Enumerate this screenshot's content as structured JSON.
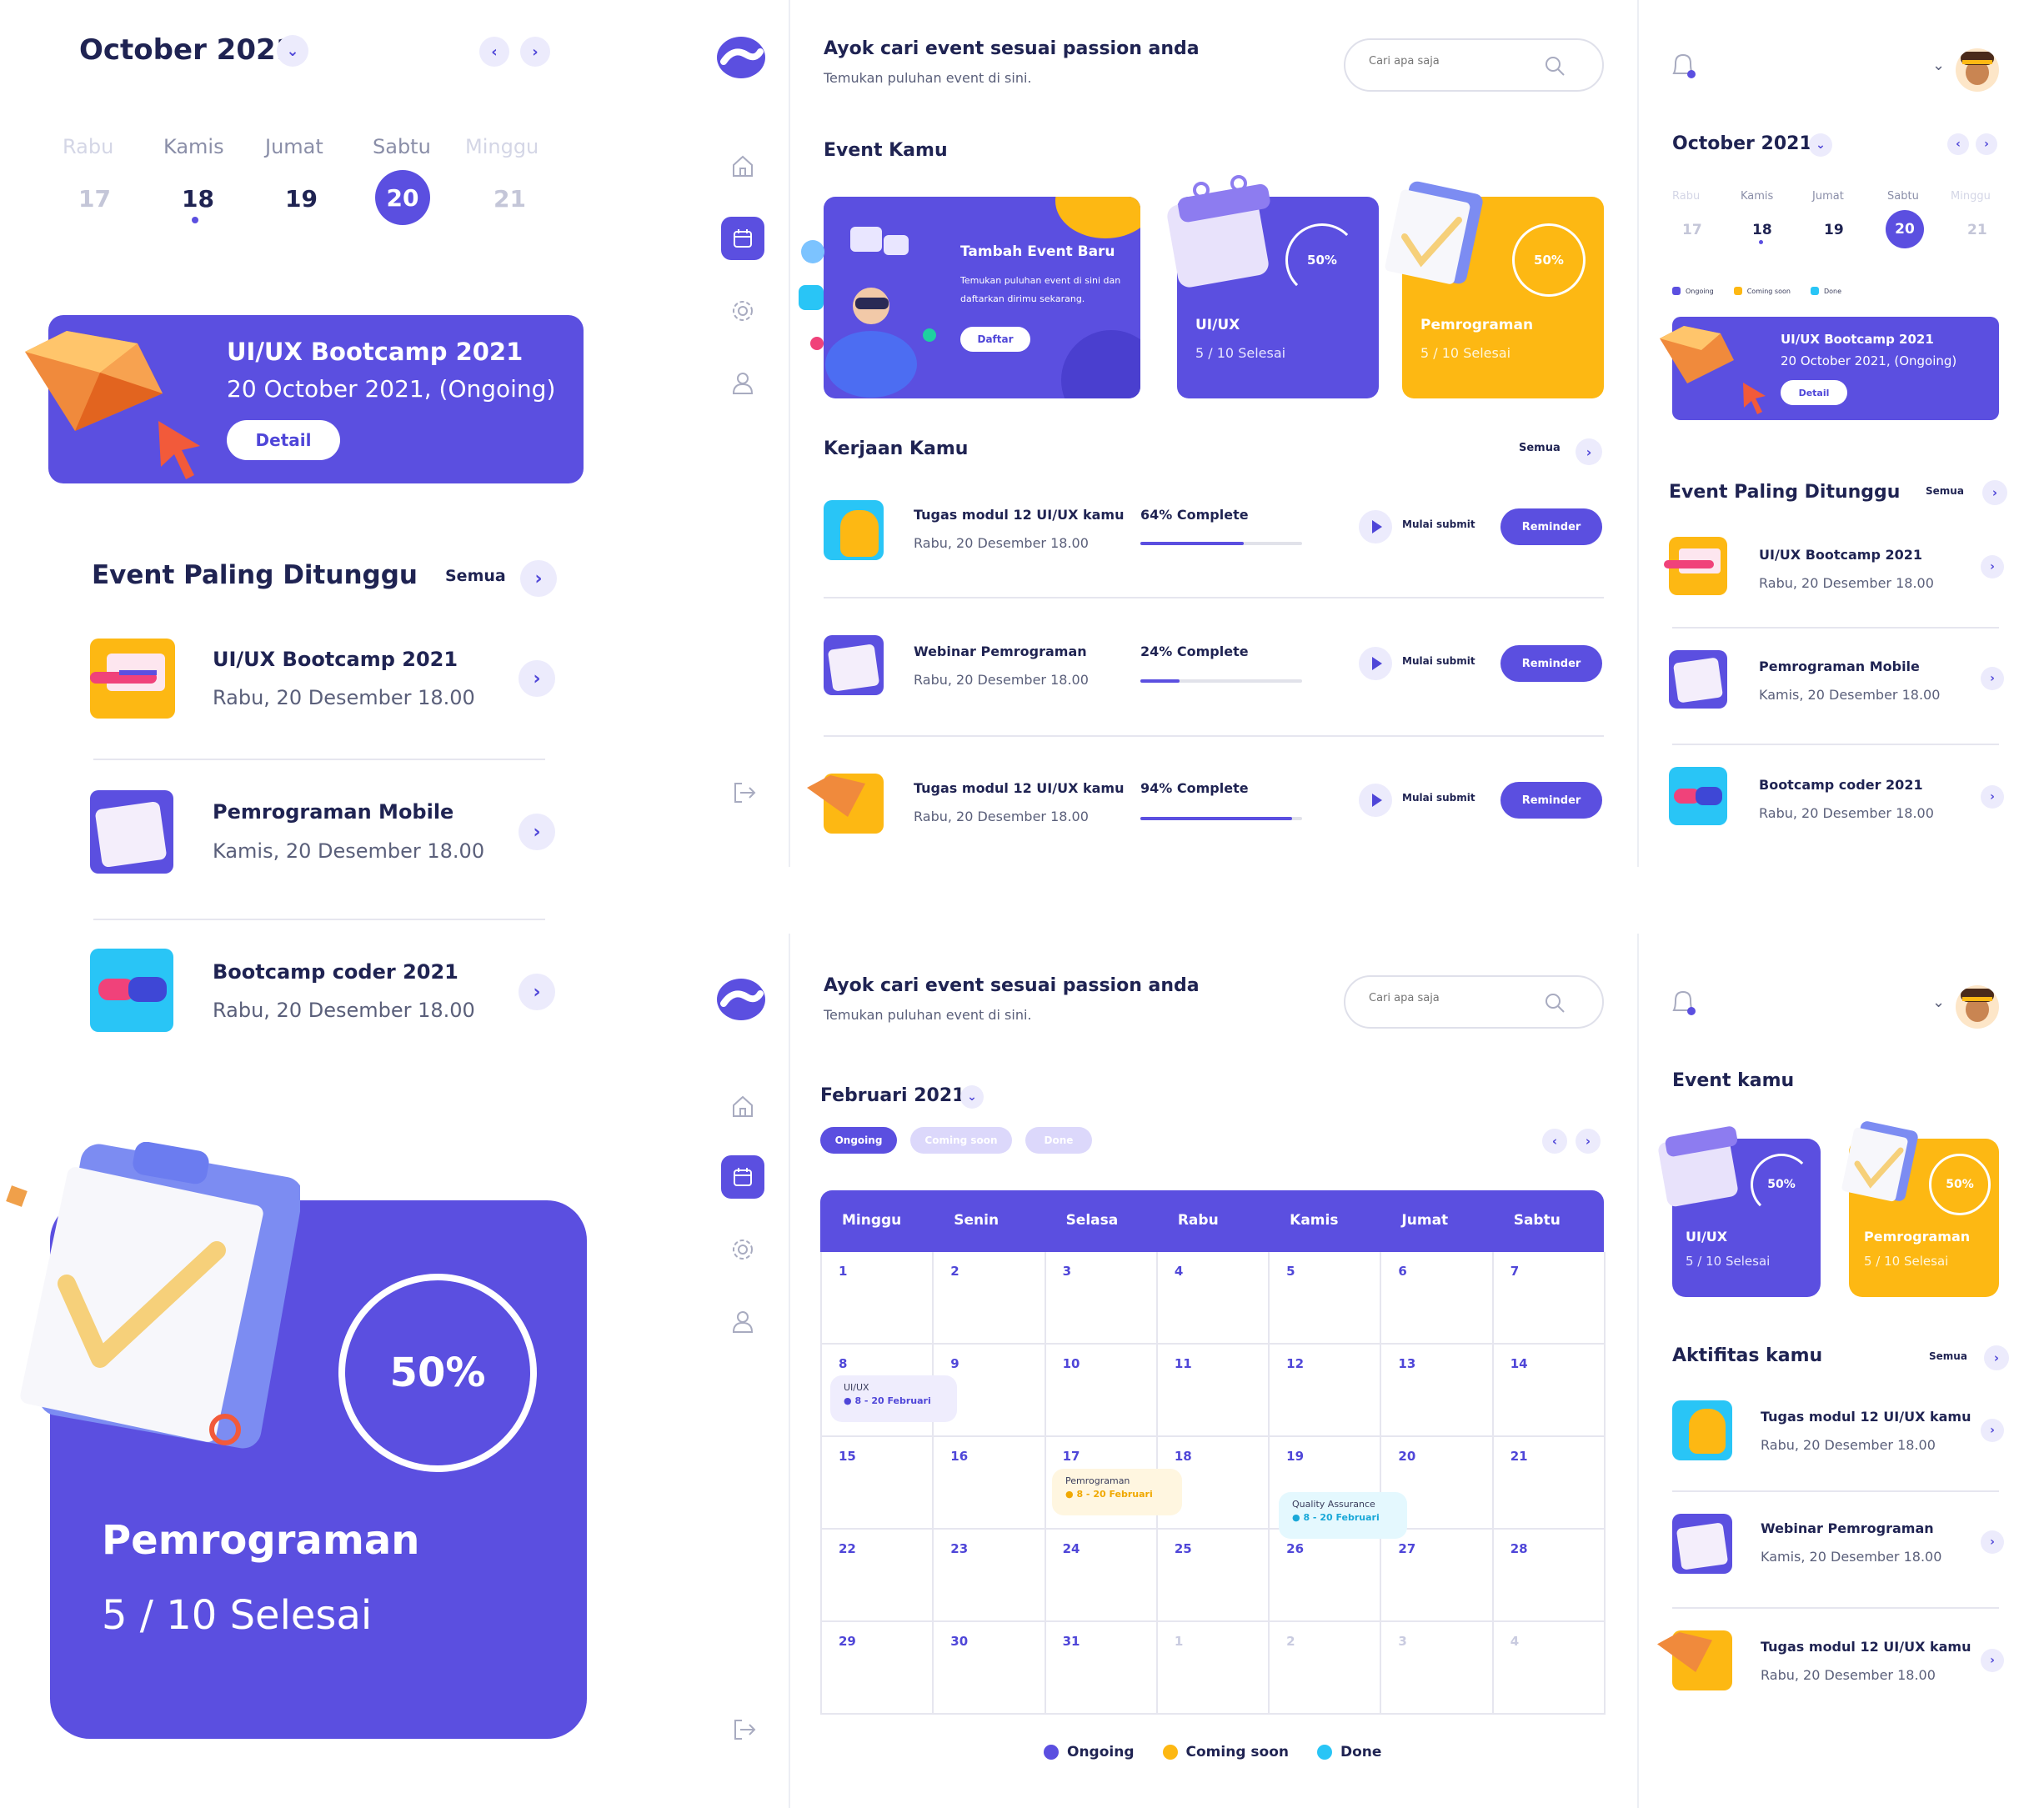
{
  "left_panel": {
    "month": "October 2021",
    "days": [
      {
        "name": "Rabu",
        "num": "17"
      },
      {
        "name": "Kamis",
        "num": "18"
      },
      {
        "name": "Jumat",
        "num": "19"
      },
      {
        "name": "Sabtu",
        "num": "20"
      },
      {
        "name": "Minggu",
        "num": "21"
      }
    ],
    "banner": {
      "title": "UI/UX Bootcamp 2021",
      "subtitle": "20 October 2021, (Ongoing)",
      "button": "Detail"
    },
    "section_title": "Event Paling Ditunggu",
    "see_all": "Semua",
    "events": [
      {
        "title": "UI/UX Bootcamp 2021",
        "date": "Rabu, 20 Desember 18.00"
      },
      {
        "title": "Pemrograman Mobile",
        "date": "Kamis, 20 Desember 18.00"
      },
      {
        "title": "Bootcamp coder 2021",
        "date": "Rabu, 20 Desember 18.00"
      }
    ],
    "big_card": {
      "percent": "50%",
      "title": "Pemrograman",
      "progress": "5 / 10 Selesai"
    }
  },
  "main_top": {
    "heading": "Ayok cari event sesuai passion anda",
    "subheading": "Temukan puluhan event di sini.",
    "search_placeholder": "Cari apa saja",
    "event_section": "Event Kamu",
    "add_event": {
      "title": "Tambah Event Baru",
      "desc": "Temukan puluhan event di sini dan daftarkan dirimu sekarang.",
      "button": "Daftar"
    },
    "cards": [
      {
        "title": "UI/UX",
        "progress": "5 / 10 Selesai",
        "percent": "50%",
        "color": "#5b4fe0"
      },
      {
        "title": "Pemrograman",
        "progress": "5 / 10 Selesai",
        "percent": "50%",
        "color": "#fdb813"
      }
    ],
    "work_section": "Kerjaan Kamu",
    "see_all": "Semua",
    "tasks": [
      {
        "title": "Tugas modul 12 UI/UX kamu",
        "date": "Rabu, 20 Desember 18.00",
        "complete": "64% Complete",
        "pct": 0.64,
        "submit": "Mulai submit",
        "reminder": "Reminder"
      },
      {
        "title": "Webinar Pemrograman",
        "date": "Rabu, 20 Desember 18.00",
        "complete": "24% Complete",
        "pct": 0.24,
        "submit": "Mulai submit",
        "reminder": "Reminder"
      },
      {
        "title": "Tugas modul 12 UI/UX kamu",
        "date": "Rabu, 20 Desember 18.00",
        "complete": "94% Complete",
        "pct": 0.94,
        "submit": "Mulai submit",
        "reminder": "Reminder"
      }
    ]
  },
  "right_top": {
    "month": "October 2021",
    "days": [
      {
        "name": "Rabu",
        "num": "17"
      },
      {
        "name": "Kamis",
        "num": "18"
      },
      {
        "name": "Jumat",
        "num": "19"
      },
      {
        "name": "Sabtu",
        "num": "20"
      },
      {
        "name": "Minggu",
        "num": "21"
      }
    ],
    "legend": [
      "Ongoing",
      "Coming soon",
      "Done"
    ],
    "banner": {
      "title": "UI/UX Bootcamp 2021",
      "subtitle": "20 October 2021, (Ongoing)",
      "button": "Detail"
    },
    "section_title": "Event Paling Ditunggu",
    "see_all": "Semua",
    "events": [
      {
        "title": "UI/UX Bootcamp 2021",
        "date": "Rabu, 20 Desember 18.00"
      },
      {
        "title": "Pemrograman Mobile",
        "date": "Kamis, 20 Desember 18.00"
      },
      {
        "title": "Bootcamp coder 2021",
        "date": "Rabu, 20 Desember 18.00"
      }
    ]
  },
  "main_bottom": {
    "heading": "Ayok cari event sesuai passion anda",
    "subheading": "Temukan puluhan event di sini.",
    "search_placeholder": "Cari apa saja",
    "month": "Februari 2021",
    "filters": [
      "Ongoing",
      "Coming soon",
      "Done"
    ],
    "weekdays": [
      "Minggu",
      "Senin",
      "Selasa",
      "Rabu",
      "Kamis",
      "Jumat",
      "Sabtu"
    ],
    "weeks": [
      [
        "1",
        "2",
        "3",
        "4",
        "5",
        "6",
        "7"
      ],
      [
        "8",
        "9",
        "10",
        "11",
        "12",
        "13",
        "14"
      ],
      [
        "15",
        "16",
        "17",
        "18",
        "19",
        "20",
        "21"
      ],
      [
        "22",
        "23",
        "24",
        "25",
        "26",
        "27",
        "28"
      ],
      [
        "29",
        "30",
        "31",
        "1",
        "2",
        "3",
        "4"
      ]
    ],
    "calendar_events": [
      {
        "title": "UI/UX",
        "date": "8 - 20 Februari",
        "status": "ongoing"
      },
      {
        "title": "Pemrograman",
        "date": "8 - 20 Februari",
        "status": "coming"
      },
      {
        "title": "Quality Assurance",
        "date": "8 - 20 Februari",
        "status": "done"
      }
    ],
    "legend": [
      "Ongoing",
      "Coming soon",
      "Done"
    ]
  },
  "right_bottom": {
    "event_section": "Event kamu",
    "cards": [
      {
        "title": "UI/UX",
        "progress": "5 / 10 Selesai",
        "percent": "50%"
      },
      {
        "title": "Pemrograman",
        "progress": "5 / 10 Selesai",
        "percent": "50%"
      }
    ],
    "activity_section": "Aktifitas kamu",
    "see_all": "Semua",
    "activities": [
      {
        "title": "Tugas modul 12 UI/UX kamu",
        "date": "Rabu, 20 Desember 18.00"
      },
      {
        "title": "Webinar Pemrograman",
        "date": "Kamis, 20 Desember 18.00"
      },
      {
        "title": "Tugas modul 12 UI/UX kamu",
        "date": "Rabu, 20 Desember 18.00"
      }
    ]
  },
  "colors": {
    "primary": "#5b4fe0",
    "yellow": "#fdb813",
    "cyan": "#29c5f6",
    "navy": "#1f2352"
  }
}
